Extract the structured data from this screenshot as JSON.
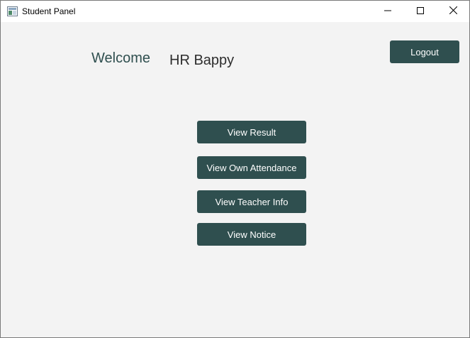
{
  "window": {
    "title": "Student Panel",
    "controls": {
      "minimize_icon": "minimize-icon",
      "maximize_icon": "maximize-icon",
      "close_icon": "close-icon"
    }
  },
  "header": {
    "welcome_label": "Welcome",
    "user_name": "HR Bappy",
    "logout_label": "Logout"
  },
  "menu": {
    "items": [
      {
        "label": "View Result"
      },
      {
        "label": "View Own Attendance"
      },
      {
        "label": "View Teacher Info"
      },
      {
        "label": "View Notice"
      }
    ]
  },
  "colors": {
    "button_bg": "#2f4f4f",
    "button_text": "#ffffff",
    "window_bg": "#f3f3f3",
    "welcome_text": "#2f4f4f"
  }
}
